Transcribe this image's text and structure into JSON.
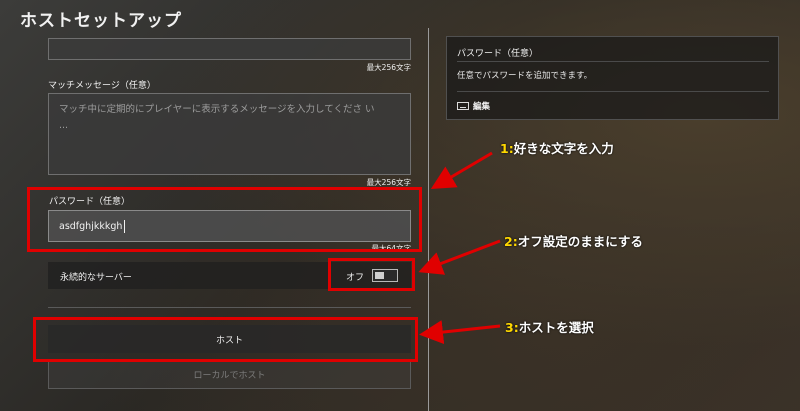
{
  "header": {
    "title": "ホストセットアップ"
  },
  "top_field": {
    "counter": "最大256文字"
  },
  "match_message": {
    "label": "マッチメッセージ（任意）",
    "placeholder_line1": "マッチ中に定期的にプレイヤーに表示するメッセージを入力してくださ い",
    "placeholder_line2": "...",
    "counter": "最大256文字"
  },
  "password": {
    "label": "パスワード（任意）",
    "value": "asdfghjkkkgh",
    "counter": "最大64文字"
  },
  "persistent_server": {
    "label": "永続的なサーバー",
    "toggle_state": "オフ",
    "toggle_on": false
  },
  "buttons": {
    "host": "ホスト",
    "local_host": "ローカルでホスト"
  },
  "info_panel": {
    "title": "パスワード（任意）",
    "description": "任意でパスワードを追加できます。",
    "edit_label": "編集",
    "edit_icon": "keyboard-icon"
  },
  "annotations": [
    {
      "number": "1:",
      "text": "好きな文字を入力"
    },
    {
      "number": "2:",
      "text": "オフ設定のままにする"
    },
    {
      "number": "3:",
      "text": "ホストを選択"
    }
  ],
  "colors": {
    "highlight": "#e00000",
    "annotation_number": "#ffd800"
  }
}
